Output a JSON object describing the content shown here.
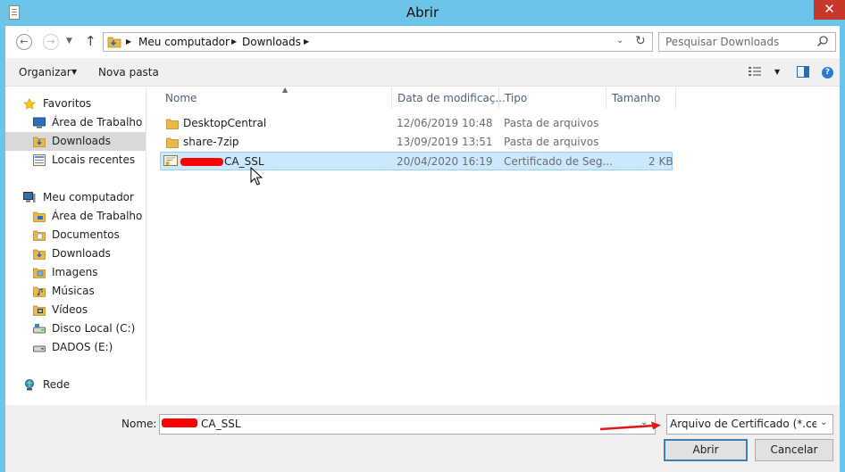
{
  "window": {
    "title": "Abrir",
    "close_glyph": "✕"
  },
  "nav": {
    "back_glyph": "←",
    "forward_glyph": "→",
    "dropdown_glyph": "▼",
    "up_glyph": "↑",
    "breadcrumbs": [
      "Meu computador",
      "Downloads"
    ],
    "address_dropdown_glyph": "⌄",
    "refresh_glyph": "↻",
    "search_placeholder": "Pesquisar Downloads"
  },
  "toolbar": {
    "organize_label": "Organizar",
    "new_folder_label": "Nova pasta",
    "dd_glyph": "▼",
    "help_glyph": "?"
  },
  "sidebar": {
    "favorites": {
      "label": "Favoritos",
      "items": [
        {
          "label": "Área de Trabalho",
          "icon": "desktop-icon"
        },
        {
          "label": "Downloads",
          "icon": "downloads-folder-icon",
          "selected": true
        },
        {
          "label": "Locais recentes",
          "icon": "recent-places-icon"
        }
      ]
    },
    "computer": {
      "label": "Meu computador",
      "items": [
        {
          "label": "Área de Trabalho",
          "icon": "desktop-folder-icon"
        },
        {
          "label": "Documentos",
          "icon": "documents-folder-icon"
        },
        {
          "label": "Downloads",
          "icon": "downloads-folder-icon"
        },
        {
          "label": "Imagens",
          "icon": "pictures-folder-icon"
        },
        {
          "label": "Músicas",
          "icon": "music-folder-icon"
        },
        {
          "label": "Vídeos",
          "icon": "videos-folder-icon"
        },
        {
          "label": "Disco Local (C:)",
          "icon": "local-disk-icon"
        },
        {
          "label": "DADOS (E:)",
          "icon": "drive-icon"
        }
      ]
    },
    "network": {
      "label": "Rede"
    }
  },
  "filelist": {
    "columns": [
      "Nome",
      "Data de modificaç...",
      "Tipo",
      "Tamanho"
    ],
    "sort_glyph": "▲",
    "rows": [
      {
        "name": "DesktopCentral",
        "date": "12/06/2019 10:48",
        "type": "Pasta de arquivos",
        "size": "",
        "icon": "folder-icon"
      },
      {
        "name": "share-7zip",
        "date": "13/09/2019 13:51",
        "type": "Pasta de arquivos",
        "size": "",
        "icon": "folder-icon"
      },
      {
        "name": "CA_SSL",
        "date": "20/04/2020 16:19",
        "type": "Certificado de Seg...",
        "size": "2 KB",
        "icon": "certificate-icon",
        "selected": true
      }
    ]
  },
  "bottom": {
    "name_label": "Nome:",
    "name_value": "CA_SSL",
    "filetype_value": "Arquivo de Certificado (*.cer;*.c",
    "dd_glyph": "⌄",
    "open_label": "Abrir",
    "cancel_label": "Cancelar"
  },
  "colors": {
    "titlebar": "#6ec4e8",
    "close": "#c7382b",
    "selection": "#cce8ff",
    "annotation": "#ff0000"
  }
}
